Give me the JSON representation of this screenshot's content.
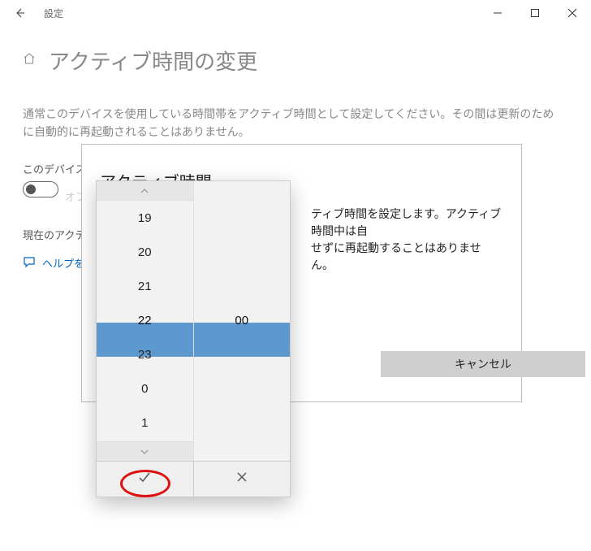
{
  "titlebar": {
    "title": "設定"
  },
  "page": {
    "title": "アクティブ時間の変更",
    "desc": "通常このデバイスを使用している時間帯をアクティブ時間として設定してください。その間は更新のために自動的に再起動されることはありません。",
    "autoLabel": "このデバイスの",
    "toggleState": "オフ",
    "currentLabel": "現在のアクティ",
    "helpText": "ヘルプを"
  },
  "dialog": {
    "title": "アクティブ時間",
    "textLine1": "ティブ時間を設定します。アクティブ時間中は自",
    "textLine2": "せずに再起動することはありません。",
    "cancel": "キャンセル"
  },
  "picker": {
    "hours": [
      "19",
      "20",
      "21",
      "22",
      "23",
      "0",
      "1"
    ],
    "selectedHour": "22",
    "selectedMinute": "00"
  }
}
